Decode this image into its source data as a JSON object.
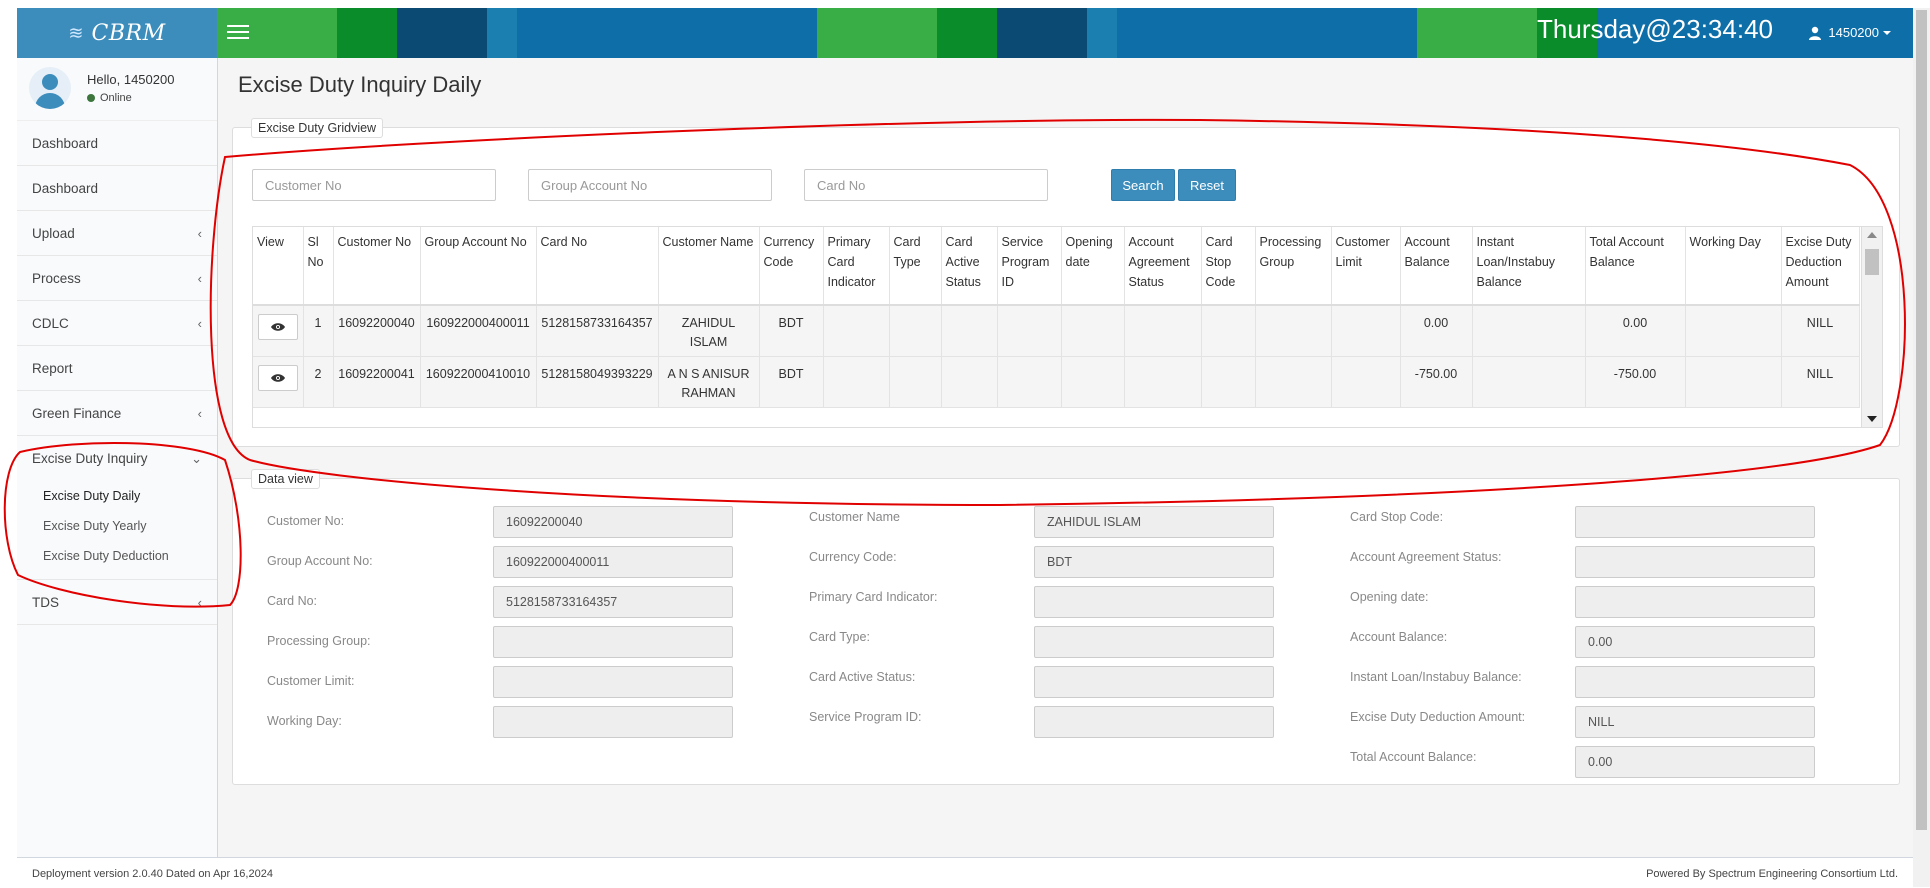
{
  "header": {
    "brand": "CBRM",
    "clock": "Thursday@23:34:40",
    "user": "1450200"
  },
  "sidebar": {
    "hello": "Hello, 1450200",
    "status": "Online",
    "items": [
      {
        "label": "Dashboard"
      },
      {
        "label": "Dashboard"
      },
      {
        "label": "Upload"
      },
      {
        "label": "Process"
      },
      {
        "label": "CDLC"
      },
      {
        "label": "Report"
      },
      {
        "label": "Green Finance"
      },
      {
        "label": "Excise Duty Inquiry"
      },
      {
        "label": "TDS"
      }
    ],
    "submenu": [
      {
        "label": "Excise Duty Daily"
      },
      {
        "label": "Excise Duty Yearly"
      },
      {
        "label": "Excise Duty Deduction"
      }
    ]
  },
  "page": {
    "title": "Excise Duty Inquiry Daily",
    "gridview_legend": "Excise Duty Gridview",
    "dataview_legend": "Data view"
  },
  "search": {
    "customer_no_placeholder": "Customer No",
    "group_account_placeholder": "Group Account No",
    "card_no_placeholder": "Card No",
    "search_label": "Search",
    "reset_label": "Reset"
  },
  "grid": {
    "columns": [
      "View",
      "Sl No",
      "Customer No",
      "Group Account No",
      "Card No",
      "Customer Name",
      "Currency Code",
      "Primary Card Indicator",
      "Card Type",
      "Card Active Status",
      "Service Program ID",
      "Opening date",
      "Account Agreement Status",
      "Card Stop Code",
      "Processing Group",
      "Customer Limit",
      "Account Balance",
      "Instant Loan/Instabuy Balance",
      "Total Account Balance",
      "Working Day",
      "Excise Duty Deduction Amount"
    ],
    "rows": [
      [
        "",
        "1",
        "16092200040",
        "160922000400011",
        "5128158733164357",
        "ZAHIDUL ISLAM",
        "BDT",
        "",
        "",
        "",
        "",
        "",
        "",
        "",
        "",
        "",
        "0.00",
        "",
        "0.00",
        "",
        "NILL"
      ],
      [
        "",
        "2",
        "16092200041",
        "160922000410010",
        "5128158049393229",
        "A N S ANISUR RAHMAN",
        "BDT",
        "",
        "",
        "",
        "",
        "",
        "",
        "",
        "",
        "",
        "-750.00",
        "",
        "-750.00",
        "",
        "NILL"
      ]
    ]
  },
  "dataview": {
    "customer_no_label": "Customer No:",
    "customer_no": "16092200040",
    "group_account_label": "Group Account No:",
    "group_account": "160922000400011",
    "card_no_label": "Card No:",
    "card_no": "5128158733164357",
    "processing_group_label": "Processing Group:",
    "processing_group": "",
    "customer_limit_label": "Customer Limit:",
    "customer_limit": "",
    "working_day_label": "Working Day:",
    "working_day": "",
    "customer_name_label": "Customer Name",
    "customer_name": "ZAHIDUL ISLAM",
    "currency_code_label": "Currency Code:",
    "currency_code": "BDT",
    "primary_card_label": "Primary Card Indicator:",
    "primary_card": "",
    "card_type_label": "Card Type:",
    "card_type": "",
    "card_active_label": "Card Active Status:",
    "card_active": "",
    "service_program_label": "Service Program ID:",
    "service_program": "",
    "card_stop_label": "Card Stop Code:",
    "card_stop": "",
    "agreement_status_label": "Account Agreement Status:",
    "agreement_status": "",
    "opening_date_label": "Opening date:",
    "opening_date": "",
    "account_balance_label": "Account Balance:",
    "account_balance": "0.00",
    "instant_loan_label": "Instant Loan/Instabuy Balance:",
    "instant_loan": "",
    "excise_amount_label": "Excise Duty Deduction Amount:",
    "excise_amount": "NILL",
    "total_balance_label": "Total Account Balance:",
    "total_balance": "0.00"
  },
  "footer": {
    "version": "Deployment version 2.0.40 Dated on Apr 16,2024",
    "powered": "Powered By Spectrum Engineering Consortium Ltd."
  },
  "colors": {
    "annotation": "#e00000",
    "primary": "#3c8dbc"
  }
}
